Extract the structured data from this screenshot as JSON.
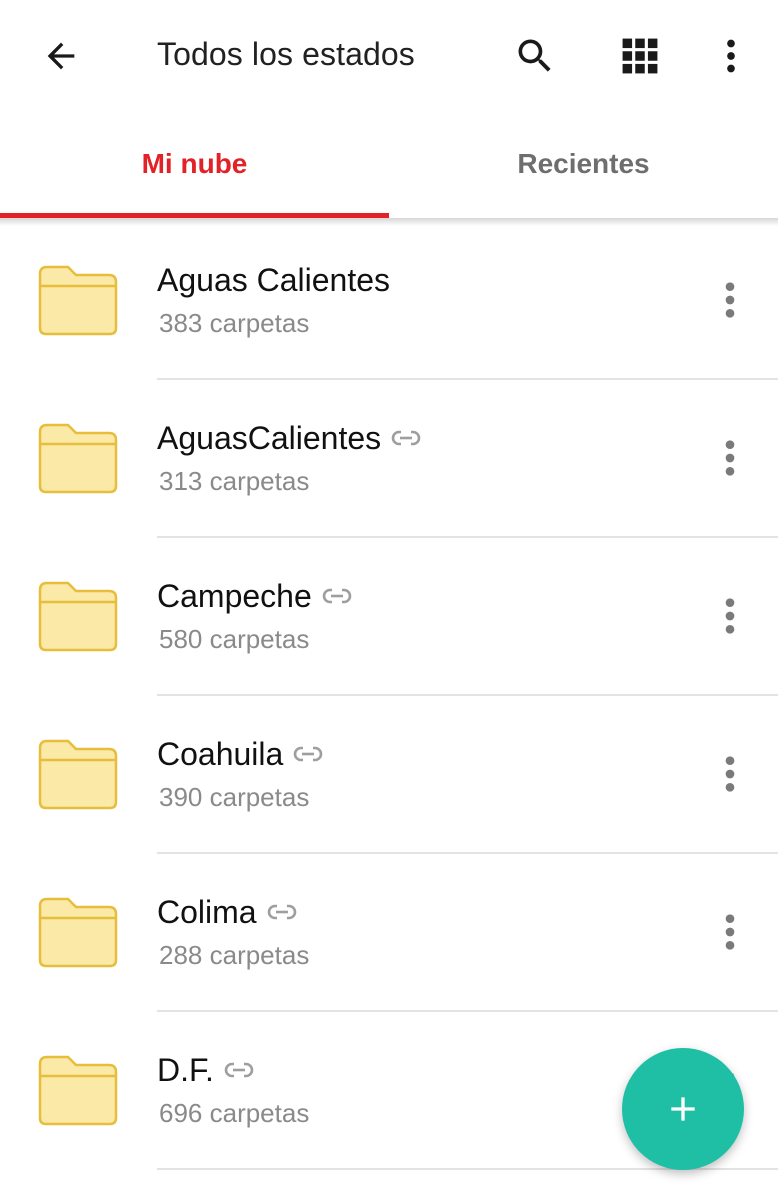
{
  "colors": {
    "accent": "#e32227",
    "tab_inactive": "#6e6e6e",
    "folder_fill": "#fbe9a8",
    "folder_stroke": "#e7be3c",
    "fab": "#1fbfa6",
    "icon": "#1a1a1a",
    "more_dots": "#7a7a7a"
  },
  "appbar": {
    "title": "Todos los estados",
    "back_icon": "arrow-left-icon",
    "search_icon": "search-icon",
    "grid_icon": "grid-view-icon",
    "more_icon": "more-vertical-icon"
  },
  "tabs": [
    {
      "label": "Mi nube",
      "active": true
    },
    {
      "label": "Recientes",
      "active": false
    }
  ],
  "folders": [
    {
      "name": "Aguas Calientes",
      "count": "383 carpetas",
      "shared": false
    },
    {
      "name": "AguasCalientes",
      "count": "313 carpetas",
      "shared": true
    },
    {
      "name": "Campeche",
      "count": "580 carpetas",
      "shared": true
    },
    {
      "name": "Coahuila",
      "count": "390 carpetas",
      "shared": true
    },
    {
      "name": "Colima",
      "count": "288 carpetas",
      "shared": true
    },
    {
      "name": "D.F.",
      "count": "696 carpetas",
      "shared": true
    }
  ],
  "fab": {
    "icon": "plus-icon"
  }
}
